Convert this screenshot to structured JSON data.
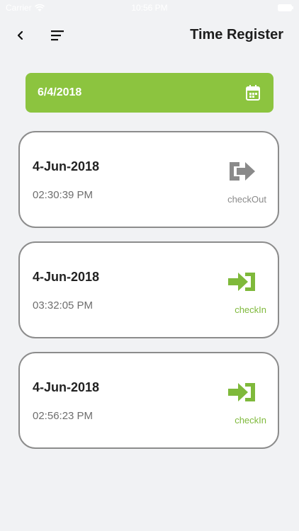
{
  "status_bar": {
    "carrier": "Carrier",
    "time": "10:56 PM"
  },
  "header": {
    "title": "Time Register"
  },
  "date_filter": {
    "value": "6/4/2018"
  },
  "entries": [
    {
      "date": "4-Jun-2018",
      "time": "02:30:39 PM",
      "type": "checkOut",
      "icon": "logout-icon"
    },
    {
      "date": "4-Jun-2018",
      "time": "03:32:05 PM",
      "type": "checkIn",
      "icon": "login-icon"
    },
    {
      "date": "4-Jun-2018",
      "time": "02:56:23 PM",
      "type": "checkIn",
      "icon": "login-icon"
    }
  ],
  "colors": {
    "accent": "#8cc43f",
    "checkin": "#7fb93b",
    "checkout": "#8a8a8a",
    "background": "#f1f2f4"
  }
}
